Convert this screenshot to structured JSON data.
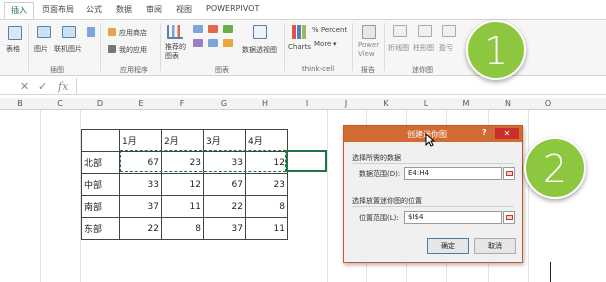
{
  "ribbon": {
    "tabs": [
      "插入",
      "页面布局",
      "公式",
      "数据",
      "审阅",
      "视图",
      "POWERPIVOT"
    ],
    "active_tab": "插入",
    "buttons": {
      "table": "表格",
      "picture": "图片",
      "online_picture": "联机图片",
      "app_store": "应用商店",
      "my_apps": "我的应用",
      "recommended_charts": "推荐的\n图表",
      "pivot_chart": "数据透视图",
      "charts": "Charts",
      "more": "More",
      "percent": "% Percent",
      "power_view": "Power\nView",
      "line_spark": "折线图",
      "column_spark": "柱形图",
      "winloss_spark": "盈亏"
    },
    "groups": {
      "illustrations": "插图",
      "apps": "应用程序",
      "charts": "图表",
      "thinkcell": "think-cell",
      "reports": "报告",
      "sparklines": "迷你图"
    }
  },
  "formula_bar": {
    "cancel": "✕",
    "enter": "✓",
    "fx": "fx",
    "value": ""
  },
  "columns": [
    "B",
    "C",
    "D",
    "E",
    "F",
    "G",
    "H",
    "I",
    "J",
    "K",
    "L",
    "M",
    "N",
    "O"
  ],
  "table": {
    "headers": [
      "",
      "1月",
      "2月",
      "3月",
      "4月"
    ],
    "rows": [
      {
        "label": "北部",
        "values": [
          "67",
          "23",
          "33",
          "12"
        ]
      },
      {
        "label": "中部",
        "values": [
          "33",
          "12",
          "67",
          "23"
        ]
      },
      {
        "label": "南部",
        "values": [
          "37",
          "11",
          "22",
          "8"
        ]
      },
      {
        "label": "东部",
        "values": [
          "22",
          "8",
          "37",
          "11"
        ]
      }
    ]
  },
  "dialog": {
    "title": "创建迷你图",
    "help": "?",
    "close": "✕",
    "section1": "选择所需的数据",
    "data_range_label": "数据范围(D):",
    "data_range_value": "E4:H4",
    "section2": "选择放置迷你图的位置",
    "location_label": "位置范围(L):",
    "location_value": "$I$4",
    "ok": "确定",
    "cancel": "取消"
  },
  "badges": [
    "1",
    "2"
  ],
  "colors": {
    "excel_green": "#217346",
    "badge_green": "#8dc63f",
    "dialog_title": "#d26a34"
  }
}
